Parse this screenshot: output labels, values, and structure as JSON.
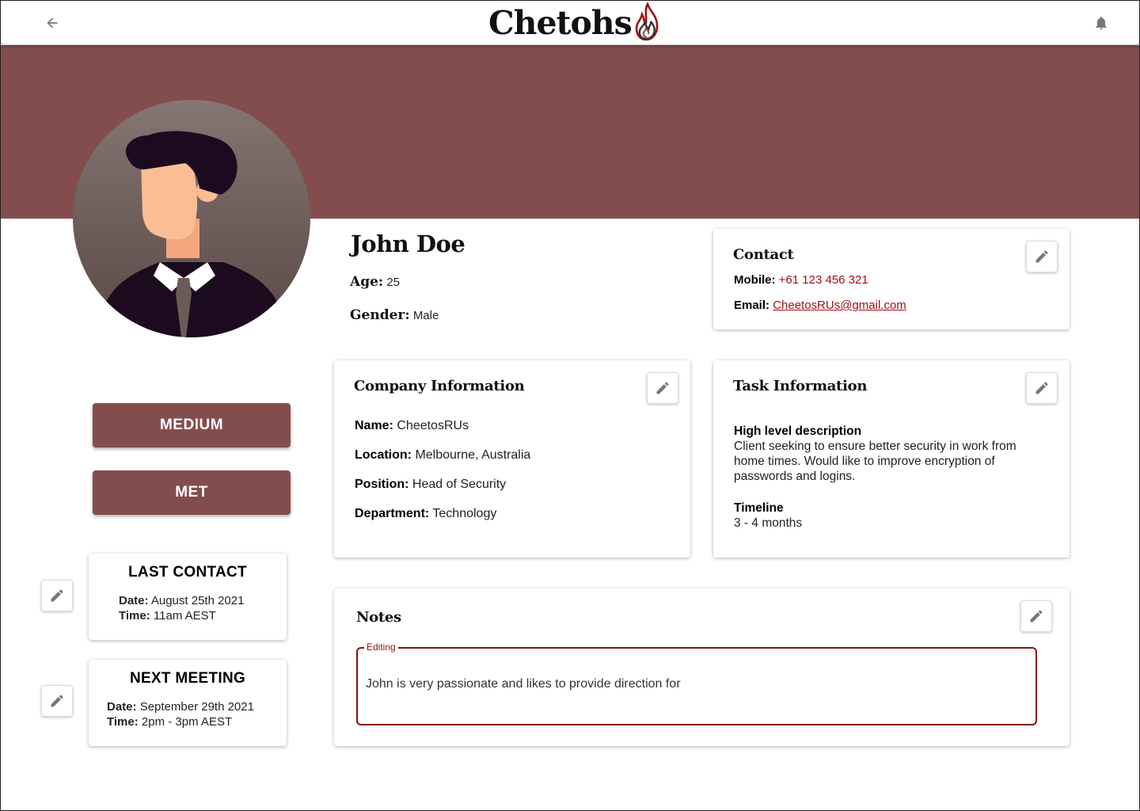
{
  "app": {
    "logo_text": "Chetohs"
  },
  "header": {
    "back_icon": "arrow-left-icon",
    "bell_icon": "bell-icon"
  },
  "colors": {
    "brand": "#844d4d",
    "accent_red": "#a00f14",
    "focus": "#8b1014"
  },
  "profile": {
    "name": "John Doe",
    "age_label": "Age:",
    "age": "25",
    "gender_label": "Gender:",
    "gender": "Male"
  },
  "status_buttons": {
    "priority": "MEDIUM",
    "stage": "MET"
  },
  "last_contact": {
    "title": "LAST CONTACT",
    "date_label": "Date:",
    "date": "August 25th 2021",
    "time_label": "Time:",
    "time": "11am AEST"
  },
  "next_meeting": {
    "title": "NEXT MEETING",
    "date_label": "Date:",
    "date": "September 29th 2021",
    "time_label": "Time:",
    "time": "2pm - 3pm AEST"
  },
  "contact": {
    "title": "Contact",
    "mobile_label": "Mobile:",
    "mobile": "+61 123 456 321",
    "email_label": "Email:",
    "email": "CheetosRUs@gmail.com"
  },
  "company": {
    "title": "Company Information",
    "name_label": "Name:",
    "name": "CheetosRUs",
    "location_label": "Location:",
    "location": "Melbourne, Australia",
    "position_label": "Position:",
    "position": "Head of Security",
    "department_label": "Department:",
    "department": "Technology"
  },
  "task": {
    "title": "Task Information",
    "description_label": "High level description",
    "description": "Client seeking to ensure better security in work from home times. Would like to improve encryption of passwords and logins.",
    "timeline_label": "Timeline",
    "timeline": "3 - 4 months"
  },
  "notes": {
    "title": "Notes",
    "legend": "Editing",
    "value": "John is very passionate and likes to provide direction for"
  }
}
